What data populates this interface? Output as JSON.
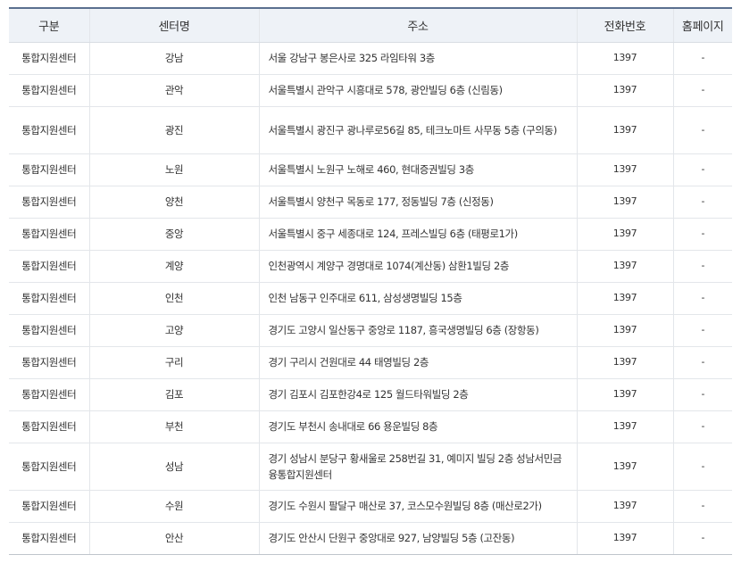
{
  "headers": [
    "구분",
    "센터명",
    "주소",
    "전화번호",
    "홈페이지"
  ],
  "rows": [
    {
      "type": "통합지원센터",
      "name": "강남",
      "address": "서울 강남구 봉은사로 325 라임타워 3층",
      "phone": "1397",
      "homepage": "-"
    },
    {
      "type": "통합지원센터",
      "name": "관악",
      "address": "서울특별시 관악구 시흥대로 578, 광안빌딩 6층 (신림동)",
      "phone": "1397",
      "homepage": "-"
    },
    {
      "type": "통합지원센터",
      "name": "광진",
      "address": "서울특별시 광진구 광나루로56길 85, 테크노마트 사무동 5층 (구의동)",
      "phone": "1397",
      "homepage": "-"
    },
    {
      "type": "통합지원센터",
      "name": "노원",
      "address": "서울특별시 노원구 노해로 460, 현대증권빌딩 3층",
      "phone": "1397",
      "homepage": "-"
    },
    {
      "type": "통합지원센터",
      "name": "양천",
      "address": "서울특별시 양천구 목동로 177, 정동빌딩 7층 (신정동)",
      "phone": "1397",
      "homepage": "-"
    },
    {
      "type": "통합지원센터",
      "name": "중앙",
      "address": "서울특별시 중구 세종대로 124, 프레스빌딩 6층 (태평로1가)",
      "phone": "1397",
      "homepage": "-"
    },
    {
      "type": "통합지원센터",
      "name": "계양",
      "address": "인천광역시 계양구 경명대로 1074(계산동) 삼환1빌딩 2층",
      "phone": "1397",
      "homepage": "-"
    },
    {
      "type": "통합지원센터",
      "name": "인천",
      "address": "인천 남동구 인주대로 611, 삼성생명빌딩 15층",
      "phone": "1397",
      "homepage": "-"
    },
    {
      "type": "통합지원센터",
      "name": "고양",
      "address": "경기도 고양시 일산동구 중앙로 1187, 흥국생명빌딩 6층 (장항동)",
      "phone": "1397",
      "homepage": "-"
    },
    {
      "type": "통합지원센터",
      "name": "구리",
      "address": "경기 구리시 건원대로 44 태영빌딩 2층",
      "phone": "1397",
      "homepage": "-"
    },
    {
      "type": "통합지원센터",
      "name": "김포",
      "address": "경기 김포시 김포한강4로 125 월드타워빌딩 2층",
      "phone": "1397",
      "homepage": "-"
    },
    {
      "type": "통합지원센터",
      "name": "부천",
      "address": "경기도 부천시 송내대로 66 용운빌딩 8층",
      "phone": "1397",
      "homepage": "-"
    },
    {
      "type": "통합지원센터",
      "name": "성남",
      "address": "경기 성남시 분당구 황새울로 258번길 31, 예미지 빌딩 2층 성남서민금융통합지원센터",
      "phone": "1397",
      "homepage": "-"
    },
    {
      "type": "통합지원센터",
      "name": "수원",
      "address": "경기도 수원시 팔달구 매산로 37, 코스모수원빌딩 8층 (매산로2가)",
      "phone": "1397",
      "homepage": "-"
    },
    {
      "type": "통합지원센터",
      "name": "안산",
      "address": "경기도 안산시 단원구 중앙대로 927, 남양빌딩 5층 (고잔동)",
      "phone": "1397",
      "homepage": "-"
    }
  ]
}
